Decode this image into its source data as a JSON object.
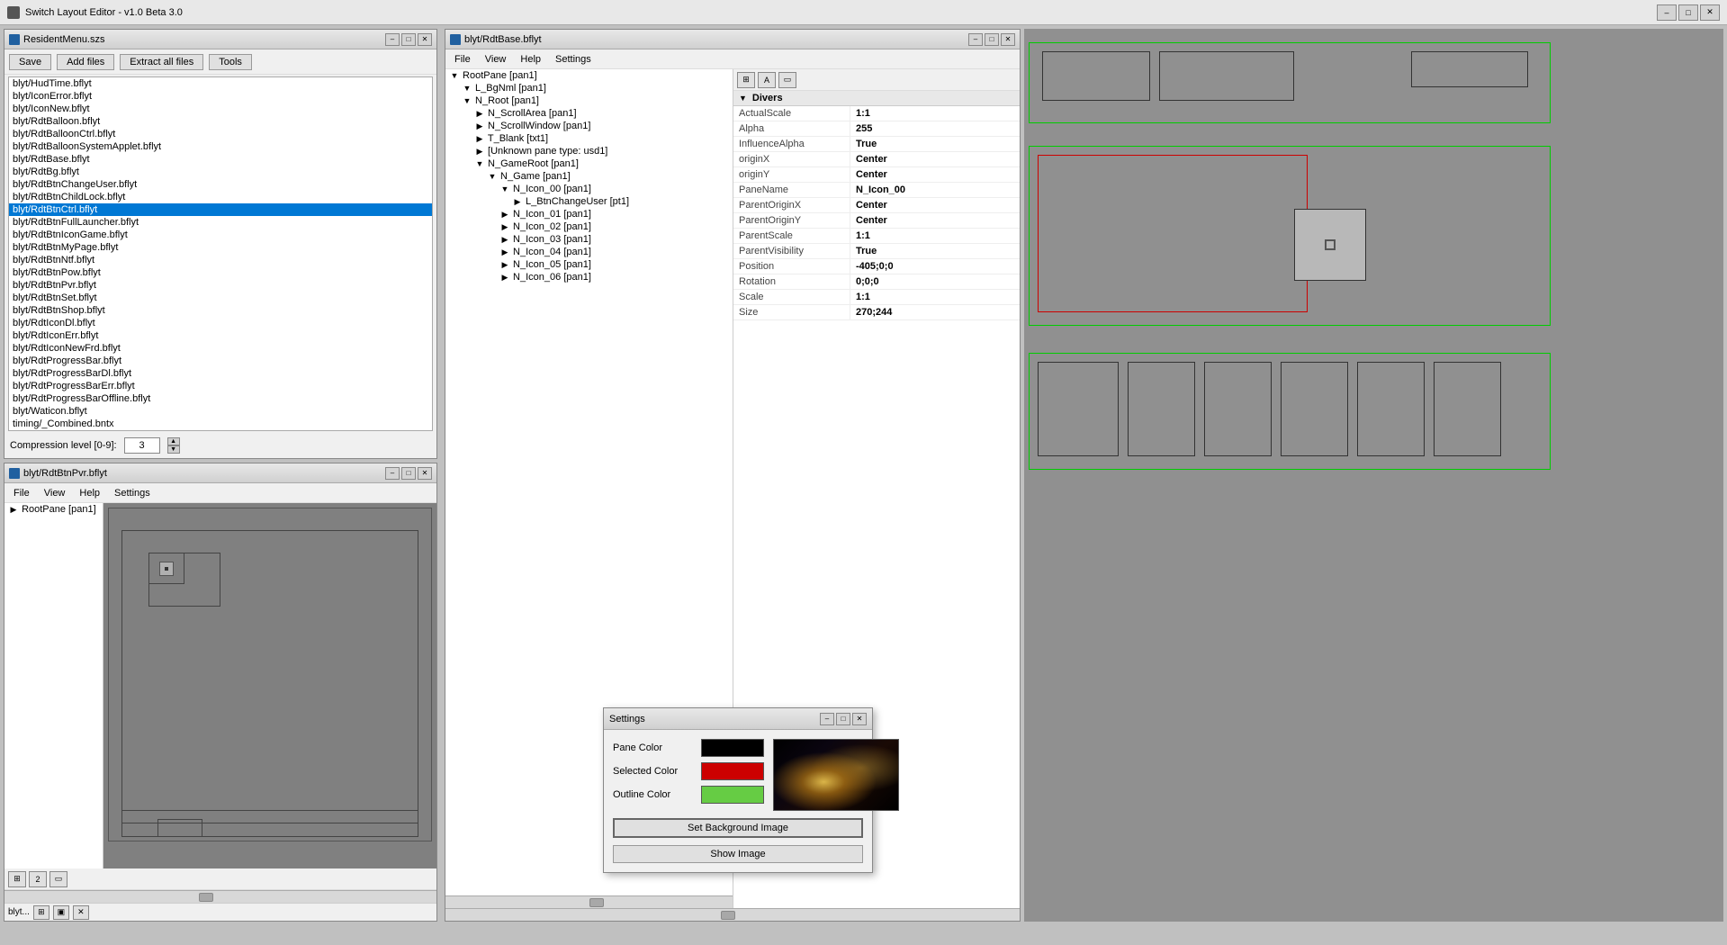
{
  "app": {
    "title": "Switch Layout Editor - v1.0 Beta 3.0",
    "icon": "app-icon"
  },
  "titleBar": {
    "title": "Switch Layout Editor - v1.0 Beta 3.0",
    "minimizeLabel": "–",
    "maximizeLabel": "□",
    "closeLabel": "✕"
  },
  "residentMenu": {
    "title": "ResidentMenu.szs",
    "toolbar": {
      "saveLabel": "Save",
      "addFilesLabel": "Add files",
      "extractAllLabel": "Extract all files",
      "toolsLabel": "Tools"
    },
    "files": [
      "blyt/HudTime.bflyt",
      "blyt/IconError.bflyt",
      "blyt/IconNew.bflyt",
      "blyt/RdtBalloon.bflyt",
      "blyt/RdtBalloonCtrl.bflyt",
      "blyt/RdtBalloonSystemApplet.bflyt",
      "blyt/RdtBase.bflyt",
      "blyt/RdtBg.bflyt",
      "blyt/RdtBtnChangeUser.bflyt",
      "blyt/RdtBtnChildLock.bflyt",
      "blyt/RdtBtnCtrl.bflyt",
      "blyt/RdtBtnFullLauncher.bflyt",
      "blyt/RdtBtnIconGame.bflyt",
      "blyt/RdtBtnMyPage.bflyt",
      "blyt/RdtBtnNtf.bflyt",
      "blyt/RdtBtnPow.bflyt",
      "blyt/RdtBtnPvr.bflyt",
      "blyt/RdtBtnSet.bflyt",
      "blyt/RdtBtnShop.bflyt",
      "blyt/RdtIconDl.bflyt",
      "blyt/RdtIconErr.bflyt",
      "blyt/RdtIconNewFrd.bflyt",
      "blyt/RdtProgressBar.bflyt",
      "blyt/RdtProgressBarDl.bflyt",
      "blyt/RdtProgressBarErr.bflyt",
      "blyt/RdtProgressBarOffline.bflyt",
      "blyt/Waticon.bflyt",
      "timing/_Combined.bntx"
    ],
    "selectedFile": "blyt/RdtBtnCtrl.bflyt",
    "compressionLabel": "Compression level [0-9]:",
    "compressionValue": "3"
  },
  "blyRdtBase": {
    "title": "blyt/RdtBase.bflyt",
    "menuItems": [
      "File",
      "View",
      "Help",
      "Settings"
    ],
    "tree": {
      "nodes": [
        {
          "label": "RootPane [pan1]",
          "depth": 0,
          "expanded": true
        },
        {
          "label": "L_BgNml [pan1]",
          "depth": 1,
          "expanded": true
        },
        {
          "label": "N_Root [pan1]",
          "depth": 1,
          "expanded": true
        },
        {
          "label": "N_ScrollArea [pan1]",
          "depth": 2,
          "expanded": false
        },
        {
          "label": "N_ScrollWindow [pan1]",
          "depth": 2,
          "expanded": false
        },
        {
          "label": "T_Blank [txt1]",
          "depth": 2,
          "expanded": false
        },
        {
          "label": "[Unknown pane type: usd1]",
          "depth": 2,
          "expanded": false
        },
        {
          "label": "N_GameRoot [pan1]",
          "depth": 2,
          "expanded": true
        },
        {
          "label": "N_Game [pan1]",
          "depth": 3,
          "expanded": true
        },
        {
          "label": "N_Icon_00 [pan1]",
          "depth": 4,
          "expanded": true
        },
        {
          "label": "L_BtnChangeUser [pt1]",
          "depth": 5,
          "expanded": false
        },
        {
          "label": "N_Icon_01 [pan1]",
          "depth": 4,
          "expanded": false
        },
        {
          "label": "N_Icon_02 [pan1]",
          "depth": 4,
          "expanded": false
        },
        {
          "label": "N_Icon_03 [pan1]",
          "depth": 4,
          "expanded": false
        },
        {
          "label": "N_Icon_04 [pan1]",
          "depth": 4,
          "expanded": false
        },
        {
          "label": "N_Icon_05 [pan1]",
          "depth": 4,
          "expanded": false
        },
        {
          "label": "N_Icon_06 [pan1]",
          "depth": 4,
          "expanded": false
        }
      ]
    },
    "properties": {
      "sectionLabel": "Divers",
      "items": [
        {
          "name": "ActualScale",
          "value": "1:1"
        },
        {
          "name": "Alpha",
          "value": "255"
        },
        {
          "name": "InfluenceAlpha",
          "value": "True"
        },
        {
          "name": "originX",
          "value": "Center"
        },
        {
          "name": "originY",
          "value": "Center"
        },
        {
          "name": "PaneName",
          "value": "N_Icon_00"
        },
        {
          "name": "ParentOriginX",
          "value": "Center"
        },
        {
          "name": "ParentOriginY",
          "value": "Center"
        },
        {
          "name": "ParentScale",
          "value": "1:1"
        },
        {
          "name": "ParentVisibility",
          "value": "True"
        },
        {
          "name": "Position",
          "value": "-405;0;0"
        },
        {
          "name": "Rotation",
          "value": "0;0;0"
        },
        {
          "name": "Scale",
          "value": "1:1"
        },
        {
          "name": "Size",
          "value": "270;244"
        }
      ]
    }
  },
  "blyRdtBtnPvr": {
    "title": "blyt/RdtBtnPvr.bflyt",
    "menuItems": [
      "File",
      "View",
      "Help",
      "Settings"
    ],
    "tree": {
      "nodes": [
        {
          "label": "RootPane [pan1]",
          "depth": 0,
          "expanded": false
        }
      ]
    }
  },
  "settings": {
    "title": "Settings",
    "paneColorLabel": "Pane Color",
    "paneColor": "#000000",
    "selectedColorLabel": "Selected Color",
    "selectedColor": "#cc0000",
    "outlineColorLabel": "Outline Color",
    "outlineColor": "#66cc44",
    "setBgImageLabel": "Set Background Image",
    "showImageLabel": "Show Image",
    "minimizeLabel": "–",
    "maximizeLabel": "□",
    "closeLabel": "✕"
  },
  "statusBar": {
    "items": [
      "blyt...",
      "icon1",
      "icon2",
      "icon3",
      "close"
    ]
  }
}
